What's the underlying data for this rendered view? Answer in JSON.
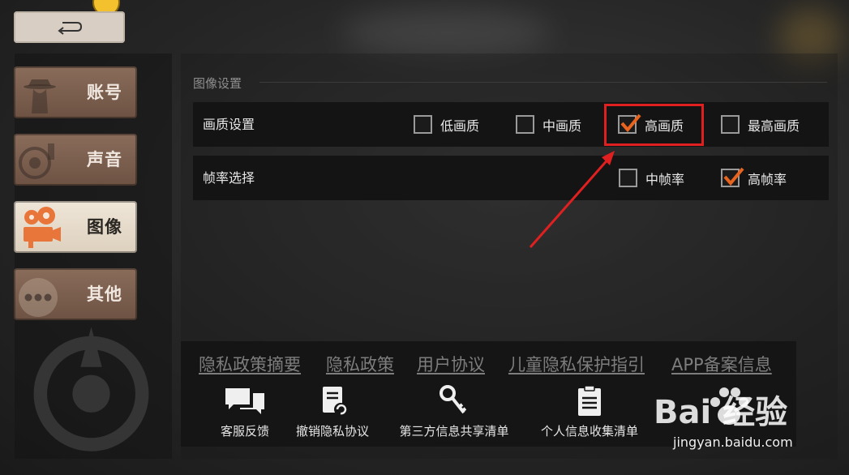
{
  "sidebar": {
    "items": [
      {
        "label": "账号",
        "icon": "detective-icon"
      },
      {
        "label": "声音",
        "icon": "speaker-icon"
      },
      {
        "label": "图像",
        "icon": "film-camera-icon",
        "active": true
      },
      {
        "label": "其他",
        "icon": "more-dots-icon"
      }
    ]
  },
  "settings": {
    "section_title": "图像设置",
    "quality": {
      "label": "画质设置",
      "options": [
        {
          "label": "低画质",
          "checked": false
        },
        {
          "label": "中画质",
          "checked": false
        },
        {
          "label": "高画质",
          "checked": true
        },
        {
          "label": "最高画质",
          "checked": false
        }
      ]
    },
    "framerate": {
      "label": "帧率选择",
      "options": [
        {
          "label": "中帧率",
          "checked": false
        },
        {
          "label": "高帧率",
          "checked": true
        }
      ]
    }
  },
  "footer": {
    "links": [
      "隐私政策摘要",
      "隐私政策",
      "用户协议",
      "儿童隐私保护指引",
      "APP备案信息"
    ],
    "actions": [
      {
        "label": "客服反馈",
        "icon": "chat-bubbles-icon"
      },
      {
        "label": "撤销隐私协议",
        "icon": "document-revoke-icon"
      },
      {
        "label": "第三方信息共享清单",
        "icon": "key-icon"
      },
      {
        "label": "个人信息收集清单",
        "icon": "clipboard-icon"
      }
    ]
  },
  "watermark": {
    "brand": "Bai 经验",
    "url": "jingyan.baidu.com"
  },
  "colors": {
    "accent_check": "#e8641f",
    "highlight_box": "#e02020",
    "annotation_arrow": "#e02020"
  }
}
